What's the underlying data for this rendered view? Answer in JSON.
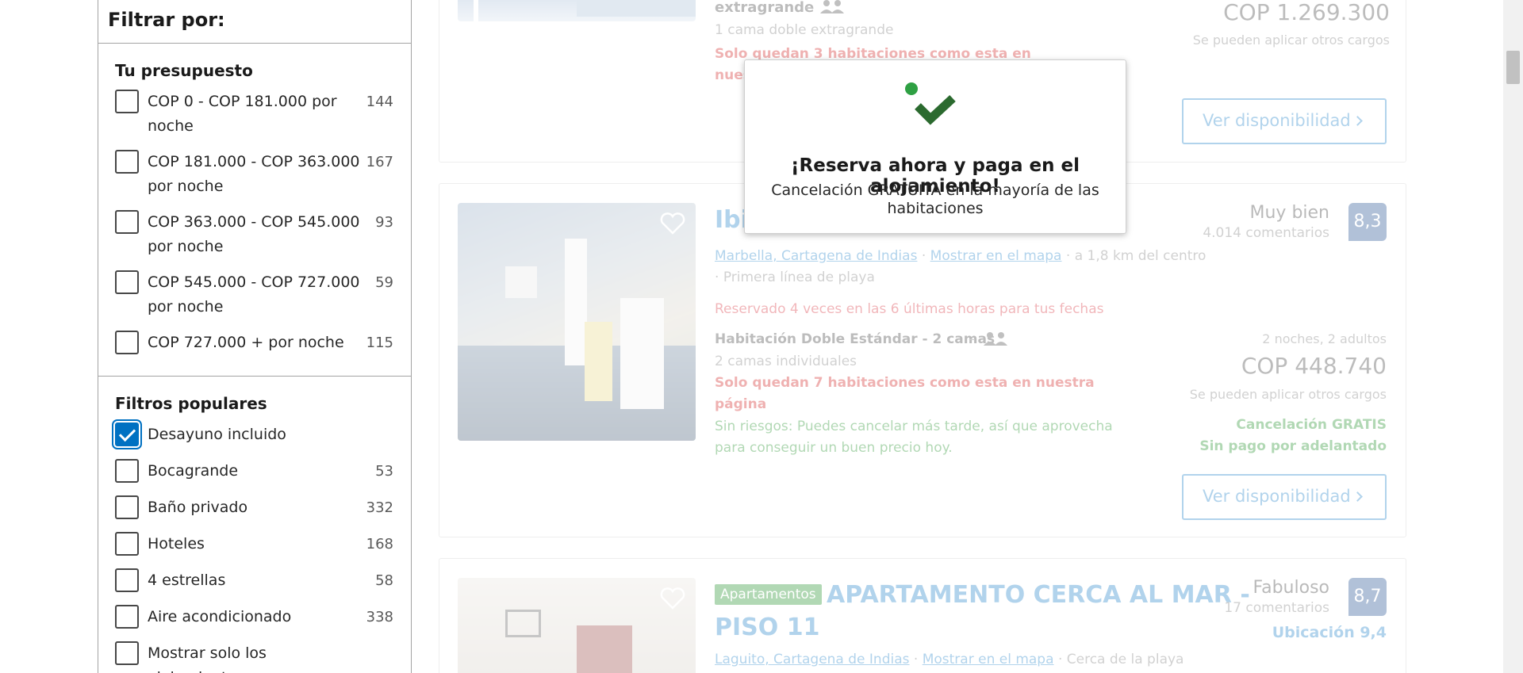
{
  "sidebar": {
    "header": "Filtrar por:",
    "budget": {
      "title": "Tu presupuesto",
      "items": [
        {
          "label": "COP 0 - COP 181.000 por noche",
          "count": "144",
          "checked": false
        },
        {
          "label": "COP 181.000 - COP 363.000 por noche",
          "count": "167",
          "checked": false
        },
        {
          "label": "COP 363.000 - COP 545.000 por noche",
          "count": "93",
          "checked": false
        },
        {
          "label": "COP 545.000 - COP 727.000 por noche",
          "count": "59",
          "checked": false
        },
        {
          "label": "COP 727.000 + por noche",
          "count": "115",
          "checked": false
        }
      ]
    },
    "popular": {
      "title": "Filtros populares",
      "items": [
        {
          "label": "Desayuno incluido",
          "count": "",
          "checked": true
        },
        {
          "label": "Bocagrande",
          "count": "53",
          "checked": false
        },
        {
          "label": "Baño privado",
          "count": "332",
          "checked": false
        },
        {
          "label": "Hoteles",
          "count": "168",
          "checked": false
        },
        {
          "label": "4 estrellas",
          "count": "58",
          "checked": false
        },
        {
          "label": "Aire acondicionado",
          "count": "338",
          "checked": false
        },
        {
          "label": "Mostrar solo los alojamientos",
          "count": "",
          "checked": false
        }
      ]
    }
  },
  "card1": {
    "room_name": "extragrande",
    "room_sep": "–",
    "beds": "1 cama doble extragrande",
    "scarcity": "Solo quedan 3 habitaciones como esta en nuestra pági",
    "price": "COP 1.269.300",
    "charges": "Se pueden aplicar otros cargos",
    "button": "Ver disponibilidad"
  },
  "card2": {
    "title_fragment": "Ibi",
    "rating_word": "Muy bien",
    "reviews": "4.014 comentarios",
    "score": "8,3",
    "location_link": "Marbella, Cartagena de Indias",
    "map_link": "Mostrar en el mapa",
    "distance": "a 1,8 km del centro",
    "beach": "Primera línea de playa",
    "booked_recently": "Reservado 4 veces en las 6 últimas horas para tus fechas",
    "room_name": "Habitación Doble Estándar - 2 camas",
    "room_sep": "–",
    "beds": "2 camas individuales",
    "scarcity_line1": "Solo quedan 7 habitaciones como esta en nuestra",
    "scarcity_line2": "página",
    "no_risk_line1": "Sin riesgos: Puedes cancelar más tarde, así que aprovecha",
    "no_risk_line2": "para conseguir un buen precio hoy.",
    "stay_info": "2 noches, 2 adultos",
    "price": "COP 448.740",
    "charges": "Se pueden aplicar otros cargos",
    "free_cancel": "Cancelación GRATIS",
    "no_prepay": "Sin pago por adelantado",
    "button": "Ver disponibilidad"
  },
  "card3": {
    "badge": "Apartamentos",
    "title_line1": "APARTAMENTO CERCA AL MAR -",
    "title_line2": "PISO 11",
    "rating_word": "Fabuloso",
    "reviews": "17 comentarios",
    "score": "8,7",
    "location_score": "Ubicación 9,4",
    "location_link": "Laguito, Cartagena de Indias",
    "map_link": "Mostrar en el mapa",
    "near": "Cerca de la playa"
  },
  "popup": {
    "title": "¡Reserva ahora y paga en el alojamiento!",
    "subtitle": "Cancelación GRATUITA en la mayoría de las habitaciones"
  },
  "colors": {
    "brand_blue": "#0071c2",
    "score_navy": "#003580",
    "scarcity_red": "#cc0000",
    "success_green": "#008009",
    "badge_green": "#008009"
  }
}
